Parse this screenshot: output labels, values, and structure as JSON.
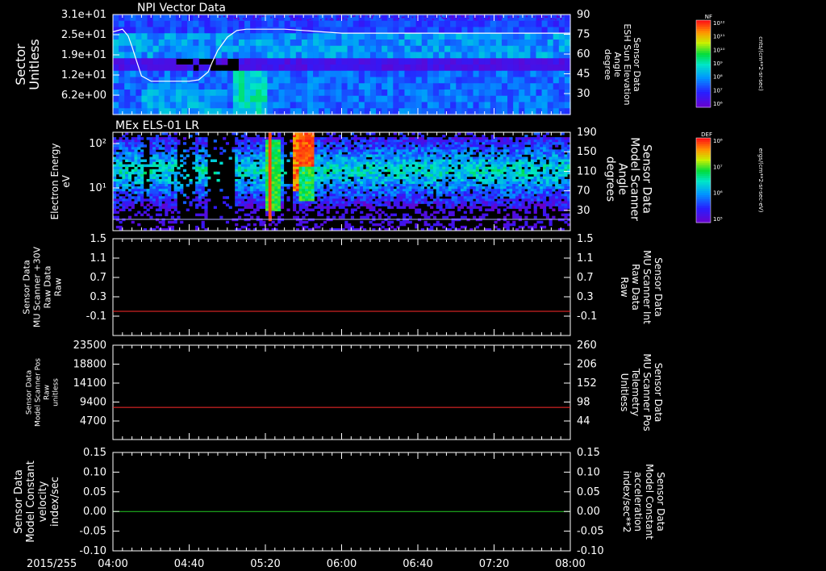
{
  "chart_data": [
    {
      "type": "heatmap",
      "title": "NPI Vector Data",
      "ylabel_left": [
        "Sector",
        "Unitless"
      ],
      "ylabel_right": [
        "Sensor Data",
        "ESH Sun Elevation",
        "Angle",
        "degree"
      ],
      "yticks_left": [
        "3.1e+01",
        "2.5e+01",
        "1.9e+01",
        "1.2e+01",
        "6.2e+00"
      ],
      "yticks_right": [
        "90",
        "75",
        "60",
        "45",
        "30"
      ],
      "yrange_right": [
        15,
        90
      ],
      "elevation_series": {
        "x": [
          "04:00",
          "04:05",
          "04:08",
          "04:10",
          "04:12",
          "04:15",
          "04:20",
          "04:25",
          "04:30",
          "04:35",
          "04:40",
          "04:45",
          "04:50",
          "04:52",
          "04:55",
          "05:00",
          "05:05",
          "05:10",
          "05:20",
          "05:30",
          "05:40",
          "05:50",
          "06:00",
          "07:00",
          "08:00"
        ],
        "y": [
          77,
          79,
          74,
          66,
          57,
          44,
          40,
          40,
          40,
          40,
          40,
          41,
          47,
          54,
          63,
          73,
          78,
          79,
          79,
          79,
          78,
          77,
          76,
          76,
          76
        ]
      },
      "colorbar": {
        "label": "NF",
        "units": "cnts/(cm**2-sr-sec)",
        "ticks": [
          "10¹²",
          "10¹¹",
          "10¹⁰",
          "10⁹",
          "10⁸",
          "10⁷",
          "10⁶"
        ]
      }
    },
    {
      "type": "heatmap",
      "title": "MEx ELS-01 LR",
      "ylabel_left": [
        "Electron Energy",
        "eV"
      ],
      "ylabel_right": [
        "Sensor Data",
        "Model Scanner",
        "Angle",
        "degrees"
      ],
      "yticks_left": [
        "10²",
        "10¹"
      ],
      "yticks_right": [
        "190",
        "150",
        "110",
        "70",
        "30"
      ],
      "yrange_right": [
        -10,
        190
      ],
      "colorbar": {
        "label": "DEF",
        "units": "ergs/(cm**2-sr-sec-eV)",
        "ticks": [
          "10⁸",
          "10⁷",
          "10⁶",
          "10⁵"
        ]
      }
    },
    {
      "type": "line",
      "ylabel_left": [
        "Sensor Data",
        "MU Scanner +30V",
        "Raw Data",
        "Raw"
      ],
      "ylabel_right": [
        "Sensor Data",
        "MU Scanner Int",
        "Raw Data",
        "Raw"
      ],
      "yticks_left": [
        "1.5",
        "1.1",
        "0.7",
        "0.3",
        "-0.1"
      ],
      "yticks_right": [
        "1.5",
        "1.1",
        "0.7",
        "0.3",
        "-0.1"
      ],
      "ylim": [
        -0.5,
        1.5
      ],
      "series": [
        {
          "value": 0.0,
          "color": "#ff2a2a"
        }
      ]
    },
    {
      "type": "line",
      "ylabel_left": [
        "Sensor Data",
        "Model Scanner Pos",
        "Raw",
        "unitless"
      ],
      "ylabel_right": [
        "Sensor Data",
        "MU Scanner Pos",
        "Telemetry",
        "Unitless"
      ],
      "yticks_left": [
        "23500",
        "18800",
        "14100",
        "9400",
        "4700"
      ],
      "yticks_right": [
        "260",
        "206",
        "152",
        "98",
        "44"
      ],
      "ylim": [
        0,
        23500
      ],
      "series": [
        {
          "value": 8000,
          "color": "#ff2a2a"
        }
      ]
    },
    {
      "type": "line",
      "ylabel_left": [
        "Sensor Data",
        "Model Constant",
        "velocity",
        "index/sec"
      ],
      "ylabel_right": [
        "Sensor Data",
        "Model Constant",
        "acceleration",
        "index/sec**2"
      ],
      "yticks_left": [
        "0.15",
        "0.10",
        "0.05",
        "0.00",
        "-0.05",
        "-0.10"
      ],
      "yticks_right": [
        "0.15",
        "0.10",
        "0.05",
        "0.00",
        "-0.05",
        "-0.10"
      ],
      "ylim": [
        -0.1,
        0.15
      ],
      "series": [
        {
          "value": 0.0,
          "color": "#22cc22"
        }
      ]
    }
  ],
  "xaxis": {
    "date": "2015/255",
    "ticks": [
      "04:00",
      "04:40",
      "05:20",
      "06:00",
      "06:40",
      "07:20",
      "08:00"
    ],
    "range": [
      "04:00",
      "08:00"
    ]
  },
  "colors": {
    "right_label_red": "#ff2a2a",
    "right_label_green": "#22cc22"
  }
}
